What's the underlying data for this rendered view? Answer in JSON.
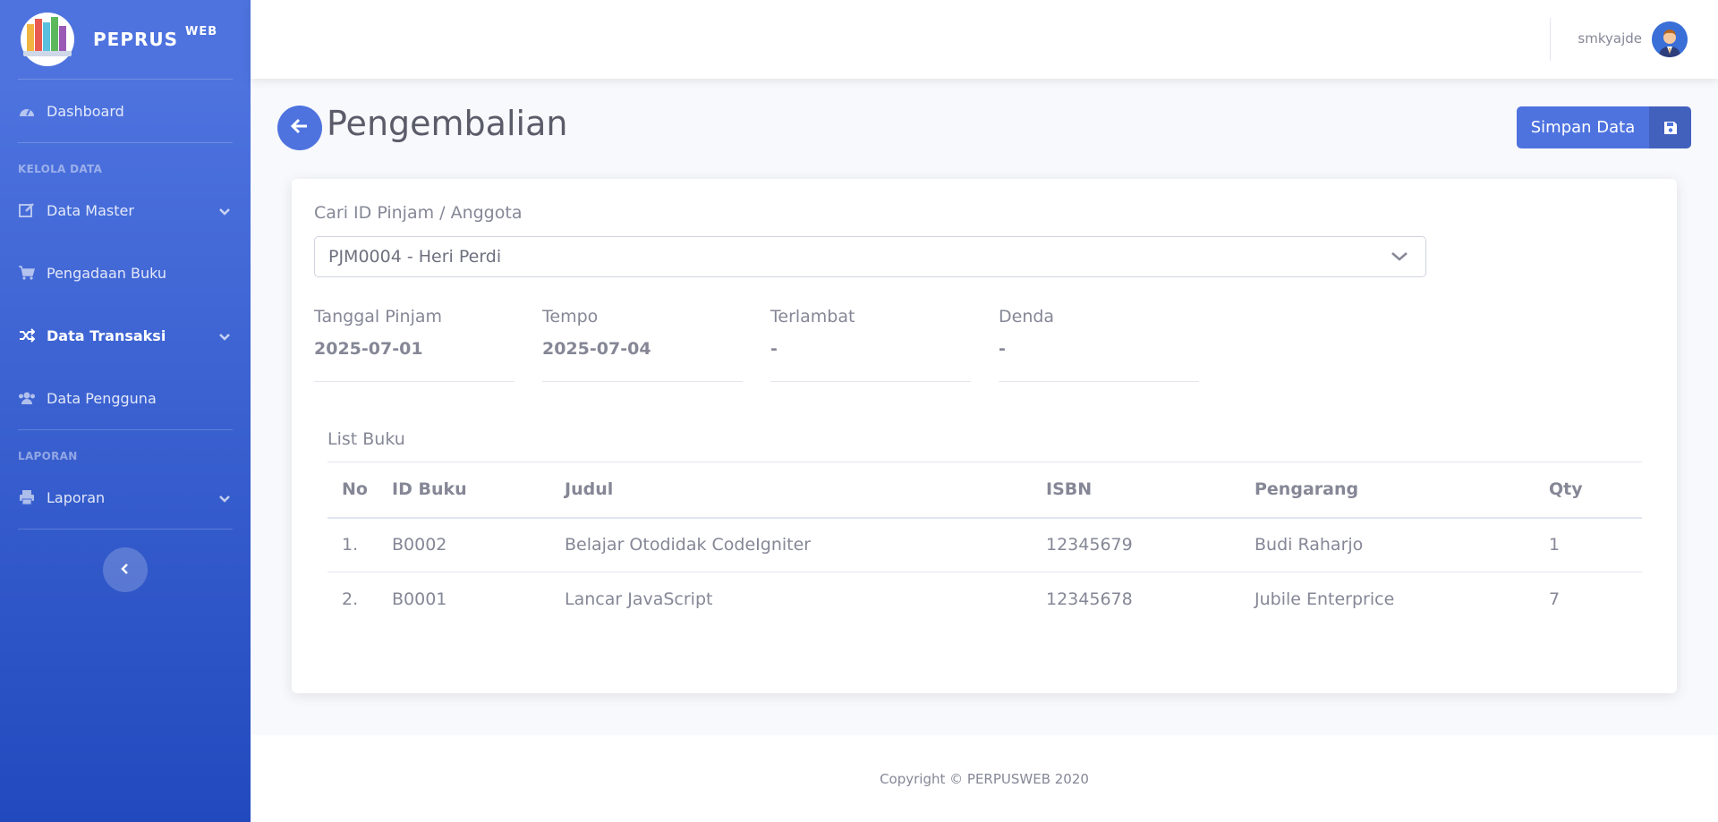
{
  "brand": {
    "name": "PEPRUS",
    "suffix": "WEB"
  },
  "sidebar": {
    "dashboard": "Dashboard",
    "heading_kelola": "KELOLA DATA",
    "data_master": "Data Master",
    "pengadaan": "Pengadaan Buku",
    "transaksi": "Data Transaksi",
    "pengguna": "Data Pengguna",
    "heading_laporan": "LAPORAN",
    "laporan": "Laporan"
  },
  "topbar": {
    "username": "smkyajde"
  },
  "page": {
    "title": "Pengembalian",
    "save_label": "Simpan Data"
  },
  "form": {
    "search_label": "Cari ID Pinjam / Anggota",
    "selected": "PJM0004 - Heri Perdi",
    "tanggal_pinjam_label": "Tanggal Pinjam",
    "tanggal_pinjam": "2025-07-01",
    "tempo_label": "Tempo",
    "tempo": "2025-07-04",
    "terlambat_label": "Terlambat",
    "terlambat": "-",
    "denda_label": "Denda",
    "denda": "-"
  },
  "list": {
    "title": "List Buku",
    "columns": [
      "No",
      "ID Buku",
      "Judul",
      "ISBN",
      "Pengarang",
      "Qty"
    ],
    "rows": [
      [
        "1.",
        "B0002",
        "Belajar Otodidak CodeIgniter",
        "12345679",
        "Budi Raharjo",
        "1"
      ],
      [
        "2.",
        "B0001",
        "Lancar JavaScript",
        "12345678",
        "Jubile Enterprice",
        "7"
      ]
    ]
  },
  "footer": {
    "copyright": "Copyright © PERPUSWEB 2020"
  },
  "colors": {
    "primary": "#4e73df",
    "text": "#858796",
    "title": "#5a5c69"
  },
  "icons": [
    "books-logo-icon",
    "tachometer-icon",
    "edit-icon",
    "cart-icon",
    "random-icon",
    "users-icon",
    "print-icon",
    "chevron-down-icon",
    "chevron-left-icon",
    "arrow-left-icon",
    "save-icon",
    "user-avatar"
  ]
}
